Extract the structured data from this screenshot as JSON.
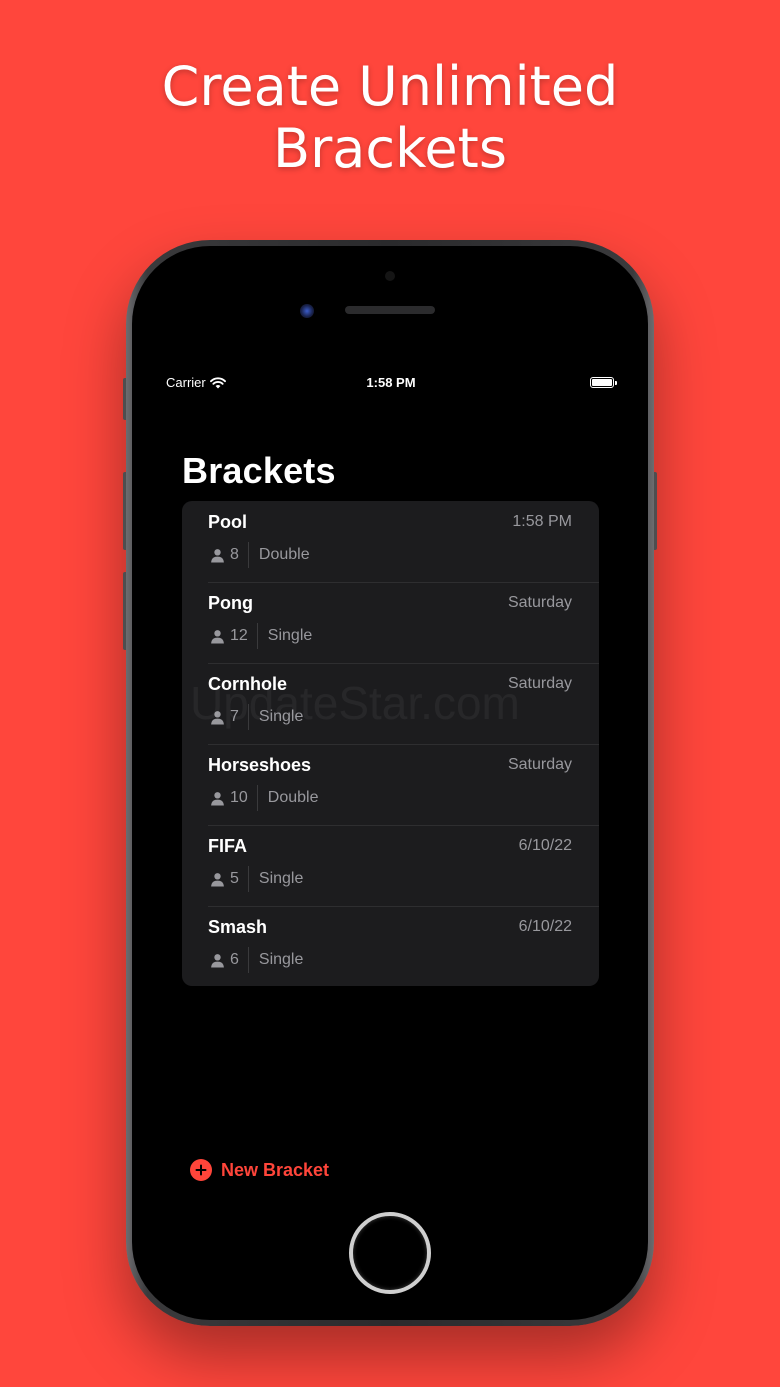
{
  "promo": {
    "headline_line1": "Create Unlimited",
    "headline_line2": "Brackets"
  },
  "status_bar": {
    "carrier": "Carrier",
    "time": "1:58 PM"
  },
  "screen": {
    "title": "Brackets",
    "watermark": "UpdateStar.com"
  },
  "brackets": [
    {
      "name": "Pool",
      "date": "1:58 PM",
      "players": "8",
      "type": "Double"
    },
    {
      "name": "Pong",
      "date": "Saturday",
      "players": "12",
      "type": "Single"
    },
    {
      "name": "Cornhole",
      "date": "Saturday",
      "players": "7",
      "type": "Single"
    },
    {
      "name": "Horseshoes",
      "date": "Saturday",
      "players": "10",
      "type": "Double"
    },
    {
      "name": "FIFA",
      "date": "6/10/22",
      "players": "5",
      "type": "Single"
    },
    {
      "name": "Smash",
      "date": "6/10/22",
      "players": "6",
      "type": "Single"
    }
  ],
  "actions": {
    "new_bracket_label": "New Bracket"
  },
  "icons": {
    "person": "person-icon",
    "plus": "plus-circle-icon",
    "wifi": "wifi-icon",
    "battery": "battery-icon"
  },
  "colors": {
    "background": "#FF463C",
    "accent": "#FF453A",
    "list_bg": "#1C1C1E",
    "secondary_text": "#98989D"
  }
}
